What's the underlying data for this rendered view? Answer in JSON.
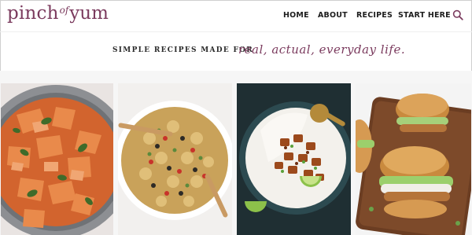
{
  "logo": {
    "word1": "pinch",
    "of": "of",
    "word2": "yum"
  },
  "nav": {
    "home": "HOME",
    "about": "ABOUT",
    "recipes": "RECIPES",
    "start_here": "START HERE"
  },
  "tagline": {
    "plain": "SIMPLE RECIPES MADE FOR",
    "script": "real, actual, everyday life."
  },
  "gallery": [
    {
      "icon": "creamy-pasta-photo"
    },
    {
      "icon": "pasta-salad-photo"
    },
    {
      "icon": "rice-bowl-photo"
    },
    {
      "icon": "chicken-burger-photo"
    }
  ],
  "colors": {
    "brand": "#7b3b5e",
    "nav_text": "#1d1d1d"
  }
}
